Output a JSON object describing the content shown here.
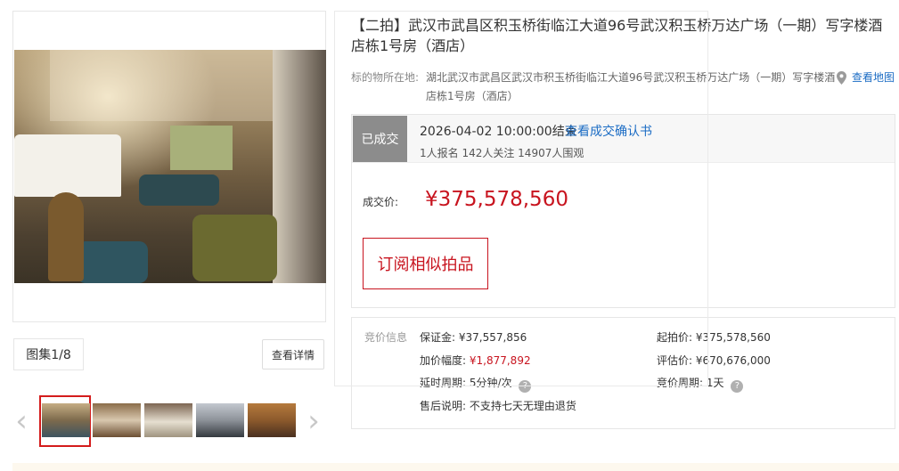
{
  "gallery": {
    "album_label": "图集1/8",
    "detail_button": "查看详情",
    "prev_arrow": "‹",
    "next_arrow": "›",
    "thumb_count": 5
  },
  "item": {
    "title": "【二拍】武汉市武昌区积玉桥街临江大道96号武汉积玉桥万达广场（一期）写字楼酒店栋1号房（酒店）",
    "location_label": "标的物所在地:",
    "location_text": "湖北武汉市武昌区武汉市积玉桥街临江大道96号武汉积玉桥万达广场（一期）写字楼酒店栋1号房（酒店）",
    "map_link": "查看地图"
  },
  "status": {
    "badge": "已成交",
    "end_time": "2026-04-02 10:00:00结束",
    "confirm_link": "查看成交确认书",
    "stats": "1人报名  142人关注  14907人围观",
    "deal_label": "成交价:",
    "deal_price": "¥375,578,560",
    "subscribe_button": "订阅相似拍品"
  },
  "bidding": {
    "title": "竞价信息",
    "deposit_label": "保证金:",
    "deposit_value": "¥37,557,856",
    "start_label": "起拍价:",
    "start_value": "¥375,578,560",
    "increment_label": "加价幅度:",
    "increment_value": "¥1,877,892",
    "appraise_label": "评估价:",
    "appraise_value": "¥670,676,000",
    "delay_label": "延时周期:",
    "delay_value": "5分钟/次",
    "cycle_label": "竞价周期:",
    "cycle_value": "1天",
    "aftersale_label": "售后说明:",
    "aftersale_value": "不支持七天无理由退货"
  },
  "colors": {
    "accent_red": "#c8141f",
    "link_blue": "#1b6cc4",
    "badge_gray": "#8c8c8c"
  }
}
